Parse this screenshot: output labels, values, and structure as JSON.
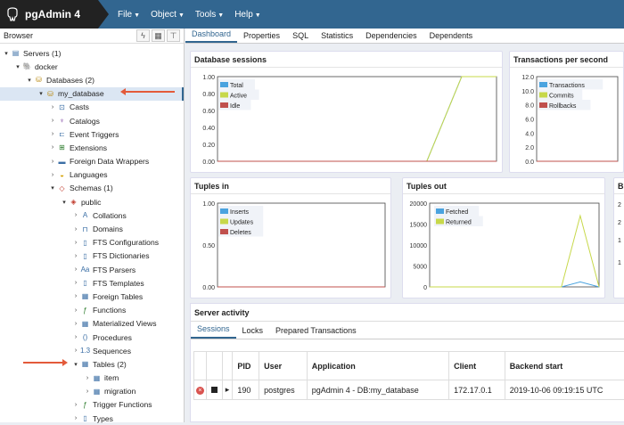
{
  "app": {
    "title": "pgAdmin 4"
  },
  "menu": [
    {
      "label": "File"
    },
    {
      "label": "Object"
    },
    {
      "label": "Tools"
    },
    {
      "label": "Help"
    }
  ],
  "browser": {
    "title": "Browser",
    "tree": [
      {
        "label": "Servers (1)",
        "icon": "servers-icon"
      },
      {
        "label": "docker",
        "icon": "server-icon"
      },
      {
        "label": "Databases (2)",
        "icon": "databases-icon"
      },
      {
        "label": "my_database",
        "icon": "database-icon"
      },
      {
        "label": "Casts",
        "icon": "casts-icon"
      },
      {
        "label": "Catalogs",
        "icon": "catalogs-icon"
      },
      {
        "label": "Event Triggers",
        "icon": "event-triggers-icon"
      },
      {
        "label": "Extensions",
        "icon": "extensions-icon"
      },
      {
        "label": "Foreign Data Wrappers",
        "icon": "fdw-icon"
      },
      {
        "label": "Languages",
        "icon": "languages-icon"
      },
      {
        "label": "Schemas (1)",
        "icon": "schemas-icon"
      },
      {
        "label": "public",
        "icon": "schema-icon"
      },
      {
        "label": "Collations",
        "icon": "collations-icon"
      },
      {
        "label": "Domains",
        "icon": "domains-icon"
      },
      {
        "label": "FTS Configurations",
        "icon": "fts-config-icon"
      },
      {
        "label": "FTS Dictionaries",
        "icon": "fts-dict-icon"
      },
      {
        "label": "FTS Parsers",
        "icon": "fts-parsers-icon"
      },
      {
        "label": "FTS Templates",
        "icon": "fts-templates-icon"
      },
      {
        "label": "Foreign Tables",
        "icon": "foreign-tables-icon"
      },
      {
        "label": "Functions",
        "icon": "functions-icon"
      },
      {
        "label": "Materialized Views",
        "icon": "mat-views-icon"
      },
      {
        "label": "Procedures",
        "icon": "procedures-icon"
      },
      {
        "label": "Sequences",
        "icon": "sequences-icon"
      },
      {
        "label": "Tables (2)",
        "icon": "tables-icon"
      },
      {
        "label": "item",
        "icon": "table-icon"
      },
      {
        "label": "migration",
        "icon": "table-icon"
      },
      {
        "label": "Trigger Functions",
        "icon": "trigger-functions-icon"
      },
      {
        "label": "Types",
        "icon": "types-icon"
      }
    ]
  },
  "tabs": [
    {
      "label": "Dashboard"
    },
    {
      "label": "Properties"
    },
    {
      "label": "SQL"
    },
    {
      "label": "Statistics"
    },
    {
      "label": "Dependencies"
    },
    {
      "label": "Dependents"
    }
  ],
  "charts": {
    "sessions": {
      "title": "Database sessions",
      "yticks": [
        "1.00",
        "0.80",
        "0.60",
        "0.40",
        "0.20",
        "0.00"
      ],
      "legend": [
        "Total",
        "Active",
        "Idle"
      ]
    },
    "tps": {
      "title": "Transactions per second",
      "yticks": [
        "12.0",
        "10.0",
        "8.0",
        "6.0",
        "4.0",
        "2.0",
        "0.0"
      ],
      "legend": [
        "Transactions",
        "Commits",
        "Rollbacks"
      ]
    },
    "tin": {
      "title": "Tuples in",
      "yticks": [
        "1.00",
        "0.50",
        "0.00"
      ],
      "legend": [
        "Inserts",
        "Updates",
        "Deletes"
      ]
    },
    "tout": {
      "title": "Tuples out",
      "yticks": [
        "20000",
        "15000",
        "10000",
        "5000",
        "0"
      ],
      "legend": [
        "Fetched",
        "Returned"
      ]
    },
    "partial": {
      "title": "B",
      "yticks": [
        "2",
        "2",
        "1",
        "1"
      ]
    }
  },
  "colors": {
    "blue": "#4aa3df",
    "yellowgreen": "#c7d84a",
    "red": "#c0504d",
    "header": "#326690"
  },
  "chart_data": [
    {
      "type": "line",
      "title": "Database sessions",
      "ylim": [
        0,
        1
      ],
      "series": [
        {
          "name": "Total",
          "values": [
            0,
            0,
            0,
            0,
            0,
            0,
            0,
            1,
            1
          ]
        },
        {
          "name": "Active",
          "values": [
            0,
            0,
            0,
            0,
            0,
            0,
            0,
            1,
            1
          ]
        },
        {
          "name": "Idle",
          "values": [
            0,
            0,
            0,
            0,
            0,
            0,
            0,
            0,
            0
          ]
        }
      ]
    },
    {
      "type": "line",
      "title": "Transactions per second",
      "ylim": [
        0,
        12
      ],
      "series": [
        {
          "name": "Transactions",
          "values": [
            0,
            0,
            0,
            0,
            0
          ]
        },
        {
          "name": "Commits",
          "values": [
            0,
            0,
            0,
            0,
            0
          ]
        },
        {
          "name": "Rollbacks",
          "values": [
            0,
            0,
            0,
            0,
            0
          ]
        }
      ]
    },
    {
      "type": "line",
      "title": "Tuples in",
      "ylim": [
        0,
        1
      ],
      "series": [
        {
          "name": "Inserts",
          "values": [
            0,
            0,
            0
          ]
        },
        {
          "name": "Updates",
          "values": [
            0,
            0,
            0
          ]
        },
        {
          "name": "Deletes",
          "values": [
            0,
            0,
            0
          ]
        }
      ]
    },
    {
      "type": "line",
      "title": "Tuples out",
      "ylim": [
        0,
        20000
      ],
      "series": [
        {
          "name": "Fetched",
          "values": [
            0,
            0,
            0,
            0,
            0,
            0,
            0,
            0,
            1200,
            0
          ]
        },
        {
          "name": "Returned",
          "values": [
            0,
            0,
            0,
            0,
            0,
            0,
            0,
            0,
            17000,
            0
          ]
        }
      ]
    }
  ],
  "activity": {
    "title": "Server activity",
    "tabs": [
      {
        "label": "Sessions"
      },
      {
        "label": "Locks"
      },
      {
        "label": "Prepared Transactions"
      }
    ],
    "columns": [
      "PID",
      "User",
      "Application",
      "Client",
      "Backend start"
    ],
    "rows": [
      {
        "pid": "190",
        "user": "postgres",
        "application": "pgAdmin 4 - DB:my_database",
        "client": "172.17.0.1",
        "backend_start": "2019-10-06 09:19:15 UTC"
      }
    ]
  }
}
